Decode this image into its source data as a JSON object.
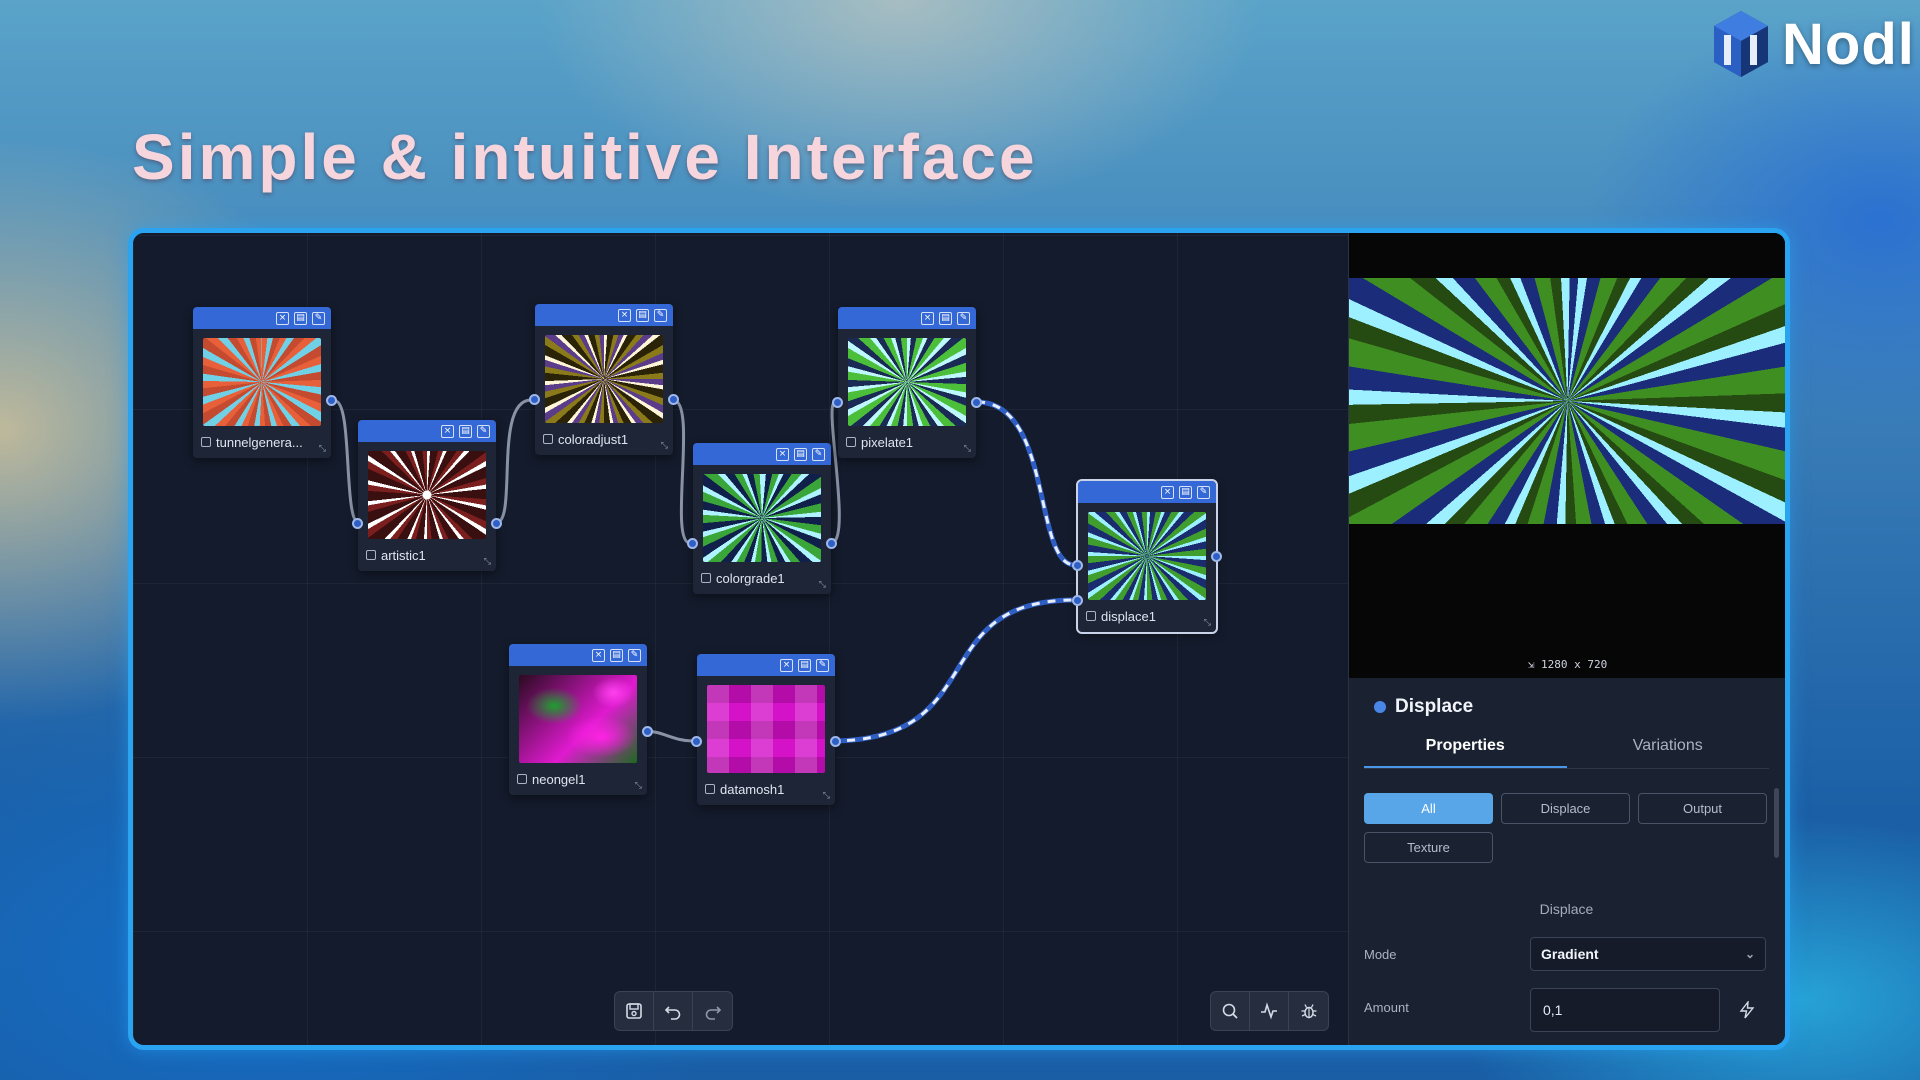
{
  "brand": {
    "name": "Nodl",
    "logo_icon": "hexagon-cube-logo"
  },
  "headline": "Simple & intuitive Interface",
  "nodes": [
    {
      "id": "tunnelgenerator1",
      "label": "tunnelgenera...",
      "thumb": "tunnel-rays-orange-cyan"
    },
    {
      "id": "artistic1",
      "label": "artistic1",
      "thumb": "rays-white-red"
    },
    {
      "id": "coloradjust1",
      "label": "coloradjust1",
      "thumb": "rays-yellow-purple"
    },
    {
      "id": "colorgrade1",
      "label": "colorgrade1",
      "thumb": "rays-cyan-green"
    },
    {
      "id": "pixelate1",
      "label": "pixelate1",
      "thumb": "rays-cyan-green-pixel"
    },
    {
      "id": "displace1",
      "label": "displace1",
      "thumb": "rays-displaced",
      "selected": true
    },
    {
      "id": "neongel1",
      "label": "neongel1",
      "thumb": "neon-magenta-green"
    },
    {
      "id": "datamosh1",
      "label": "datamosh1",
      "thumb": "magenta-blocks"
    }
  ],
  "node_header_icons": [
    "close-icon",
    "save-icon",
    "edit-icon"
  ],
  "canvas_toolbar": {
    "left": [
      {
        "name": "save-button",
        "icon": "floppy-icon"
      },
      {
        "name": "undo-button",
        "icon": "undo-icon"
      },
      {
        "name": "redo-button",
        "icon": "redo-icon"
      }
    ],
    "right": [
      {
        "name": "search-button",
        "icon": "search-icon"
      },
      {
        "name": "activity-button",
        "icon": "pulse-icon"
      },
      {
        "name": "debug-button",
        "icon": "bug-icon"
      }
    ]
  },
  "preview": {
    "resolution": "1280 x 720"
  },
  "panel": {
    "title": "Displace",
    "tabs": [
      "Properties",
      "Variations"
    ],
    "active_tab": "Properties",
    "filters": [
      "All",
      "Displace",
      "Output",
      "Texture"
    ],
    "active_filter": "All",
    "section": "Displace",
    "mode": {
      "label": "Mode",
      "value": "Gradient"
    },
    "amount": {
      "label": "Amount",
      "value": "0,1"
    }
  },
  "colors": {
    "accent": "#2aa3f0",
    "node_header": "#3468d6",
    "active_chip": "#58a6e8",
    "headline": "#f6d6dc"
  }
}
